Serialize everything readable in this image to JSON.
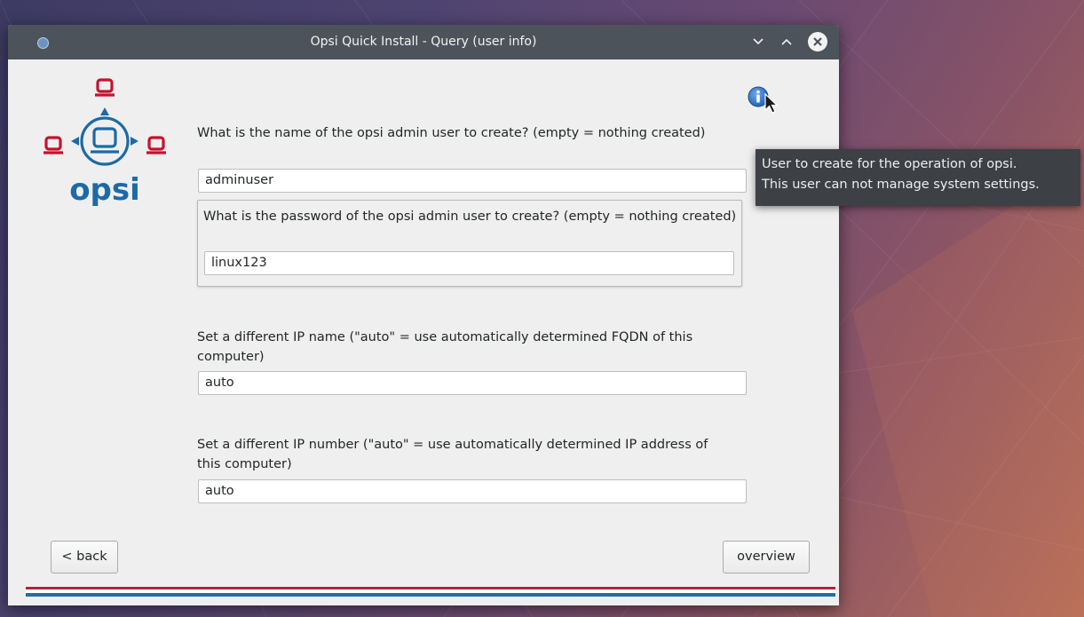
{
  "window": {
    "title": "Opsi Quick Install - Query (user info)",
    "controls": {
      "minimize_icon": "chevron-down-icon",
      "maximize_icon": "chevron-up-icon",
      "close_icon": "close-icon"
    }
  },
  "logo": {
    "text": "opsi",
    "brand_red": "#c8102e",
    "brand_blue": "#1c6aa6"
  },
  "form": {
    "admin_user": {
      "label": "What is the name of the opsi admin user to create? (empty = nothing created)",
      "value": "adminuser"
    },
    "admin_password": {
      "label": "What is the password of the opsi admin user to create? (empty = nothing created)",
      "value": "linux123"
    },
    "ip_name": {
      "label": "Set a different IP name (\"auto\" = use automatically determined FQDN of this computer)",
      "value": "auto"
    },
    "ip_number": {
      "label": "Set a different IP number (\"auto\" = use automatically determined IP address of this computer)",
      "value": "auto"
    }
  },
  "info": {
    "icon": "info-icon",
    "tooltip": {
      "line1": "User to create for the operation of opsi.",
      "line2": "This user can not manage system settings."
    }
  },
  "buttons": {
    "back": "< back",
    "overview": "overview"
  },
  "colors": {
    "stripe_red": "#b1243b",
    "stripe_blue": "#236da6",
    "titlebar": "#4d535b"
  }
}
